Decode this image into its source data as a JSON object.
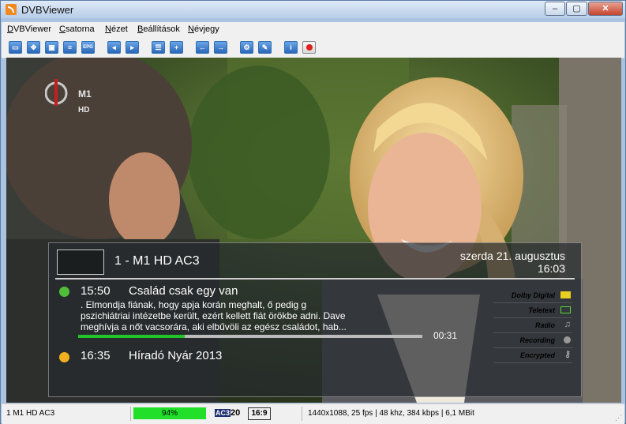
{
  "window": {
    "title": "DVBViewer"
  },
  "menu": [
    {
      "pre": "",
      "u": "D",
      "post": "VBViewer"
    },
    {
      "pre": "",
      "u": "C",
      "post": "satorna"
    },
    {
      "pre": "",
      "u": "N",
      "post": "ézet"
    },
    {
      "pre": "",
      "u": "B",
      "post": "eállítások"
    },
    {
      "pre": "",
      "u": "N",
      "post": "évjegy"
    }
  ],
  "toolbar": {
    "icons": [
      "fullscreen-icon",
      "move-icon",
      "tv-icon",
      "list-icon",
      "epg-icon",
      "channel-prev-icon",
      "channel-next-icon",
      "record-list-icon",
      "add-icon",
      "back-icon",
      "forward-icon",
      "settings-icon",
      "tools-icon",
      "info-icon",
      "record-icon"
    ],
    "epg_label": "EPG"
  },
  "logo": {
    "name": "M1",
    "quality": "HD"
  },
  "osd": {
    "channel": "1 - M1 HD AC3",
    "date": "szerda 21. augusztus",
    "time": "16:03",
    "current": {
      "start": "15:50",
      "title": "Család csak egy van",
      "description_lines": [
        ". Elmondja fiának, hogy apja korán meghalt, ő pedig g",
        "pszichiátriai intézetbe került, ezért kellett fiát örökbe adni. Dave",
        "meghívja a nőt vacsorára, aki elbűvöli az egész családot, hab..."
      ],
      "remaining": "00:31",
      "progress": 0.31,
      "dot_color": "#4fbf3a"
    },
    "next": {
      "start": "16:35",
      "title": "Híradó Nyár 2013",
      "dot_color": "#f0b020"
    },
    "features": [
      {
        "label": "Dolby Digital",
        "active": true
      },
      {
        "label": "Teletext",
        "active": true
      },
      {
        "label": "Radio",
        "active": false
      },
      {
        "label": "Recording",
        "active": false
      },
      {
        "label": "Encrypted",
        "active": false
      }
    ]
  },
  "status": {
    "channel": "1 M1 HD AC3",
    "signal": "94%",
    "signal_level": 0.94,
    "audio": "AC3",
    "audio_num": "20",
    "aspect": "16:9",
    "info": "1440x1088, 25 fps | 48 khz, 384 kbps | 6,1 MBit"
  },
  "colors": {
    "signal": "#22e02a",
    "accent": "#2a67b8"
  }
}
